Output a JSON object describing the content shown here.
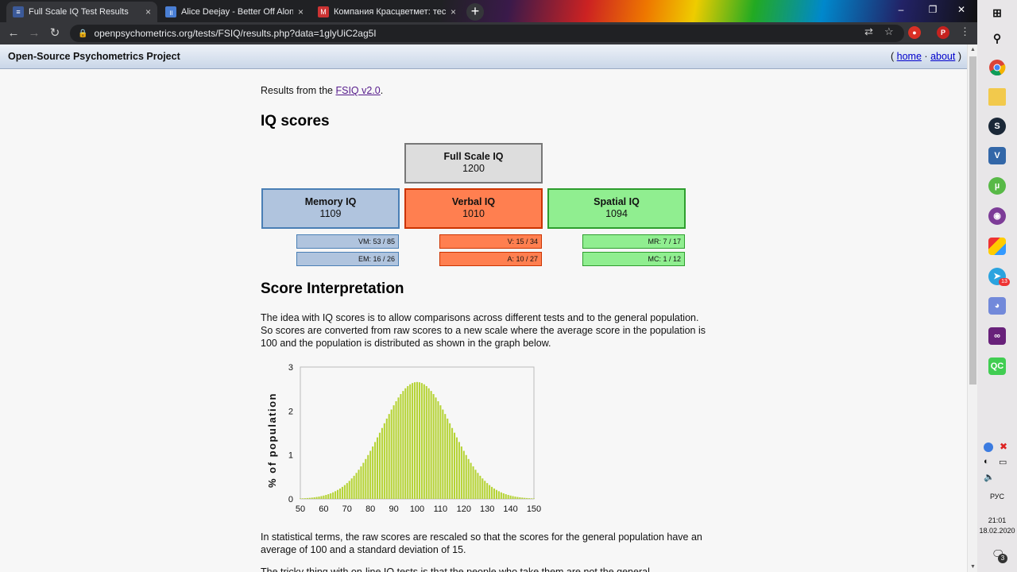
{
  "browser": {
    "tabs": [
      {
        "label": "Full Scale IQ Test Results",
        "active": true,
        "favicon_color": "#3c5a99"
      },
      {
        "label": "Alice Deejay - Better Off Alone",
        "active": false,
        "favicon_color": "#4a7fd4"
      },
      {
        "label": "Компания Красцветмет: тестово",
        "active": false,
        "favicon_color": "#c33"
      }
    ],
    "close_glyph": "×",
    "new_tab_glyph": "+",
    "window_controls": [
      "–",
      "❐",
      "✕"
    ],
    "url": "openpsychometrics.org/tests/FSIQ/results.php?data=1glyUiC2ag5I",
    "profile_initial": "P"
  },
  "site": {
    "title": "Open-Source Psychometrics Project",
    "links_open": "(",
    "home_label": "home",
    "separator": "·",
    "about_label": "about",
    "links_close": ")"
  },
  "page": {
    "intro_prefix": "Results from the ",
    "intro_link": "FSIQ v2.0",
    "intro_suffix": ".",
    "iq_heading": "IQ scores",
    "full_scale": {
      "name": "Full Scale IQ",
      "value": "1200",
      "color": "#dddddd",
      "border": "#777777"
    },
    "memory": {
      "name": "Memory IQ",
      "value": "1109",
      "color": "#b0c4de",
      "border": "#4a7fb5",
      "subscores": [
        "VM: 53 / 85",
        "EM: 16 / 26"
      ]
    },
    "verbal": {
      "name": "Verbal IQ",
      "value": "1010",
      "color": "#ff7f50",
      "border": "#cc3300",
      "subscores": [
        "V: 15 / 34",
        "A: 10 / 27"
      ]
    },
    "spatial": {
      "name": "Spatial IQ",
      "value": "1094",
      "color": "#90ee90",
      "border": "#2e9e2e",
      "subscores": [
        "MR: 7 / 17",
        "MC: 1 / 12"
      ]
    },
    "interp_heading": "Score Interpretation",
    "para1": "The idea with IQ scores is to allow comparisons across different tests and to the general population. So scores are converted from raw scores to a new scale where the average score in the population is 100 and the population is distributed as shown in the graph below.",
    "para2": "In statistical terms, the raw scores are rescaled so that the scores for the general population have an average of 100 and a standard deviation of 15.",
    "para3": "The tricky thing with on-line IQ tests is that the people who take them are not the general"
  },
  "chart_data": {
    "type": "bar",
    "distribution": "normal",
    "mean": 100,
    "sd": 15,
    "x_range": [
      50,
      150
    ],
    "xlim": [
      50,
      150
    ],
    "ylim": [
      0,
      3
    ],
    "xticks": [
      50,
      60,
      70,
      80,
      90,
      100,
      110,
      120,
      130,
      140,
      150
    ],
    "yticks": [
      0,
      1,
      2,
      3
    ],
    "ylabel": "% of population",
    "bar_color": "#b5d334"
  },
  "taskbar": {
    "language": "РУС",
    "time": "21:01",
    "date": "18.02.2020",
    "notification_count": "3",
    "telegram_badge": "13"
  }
}
